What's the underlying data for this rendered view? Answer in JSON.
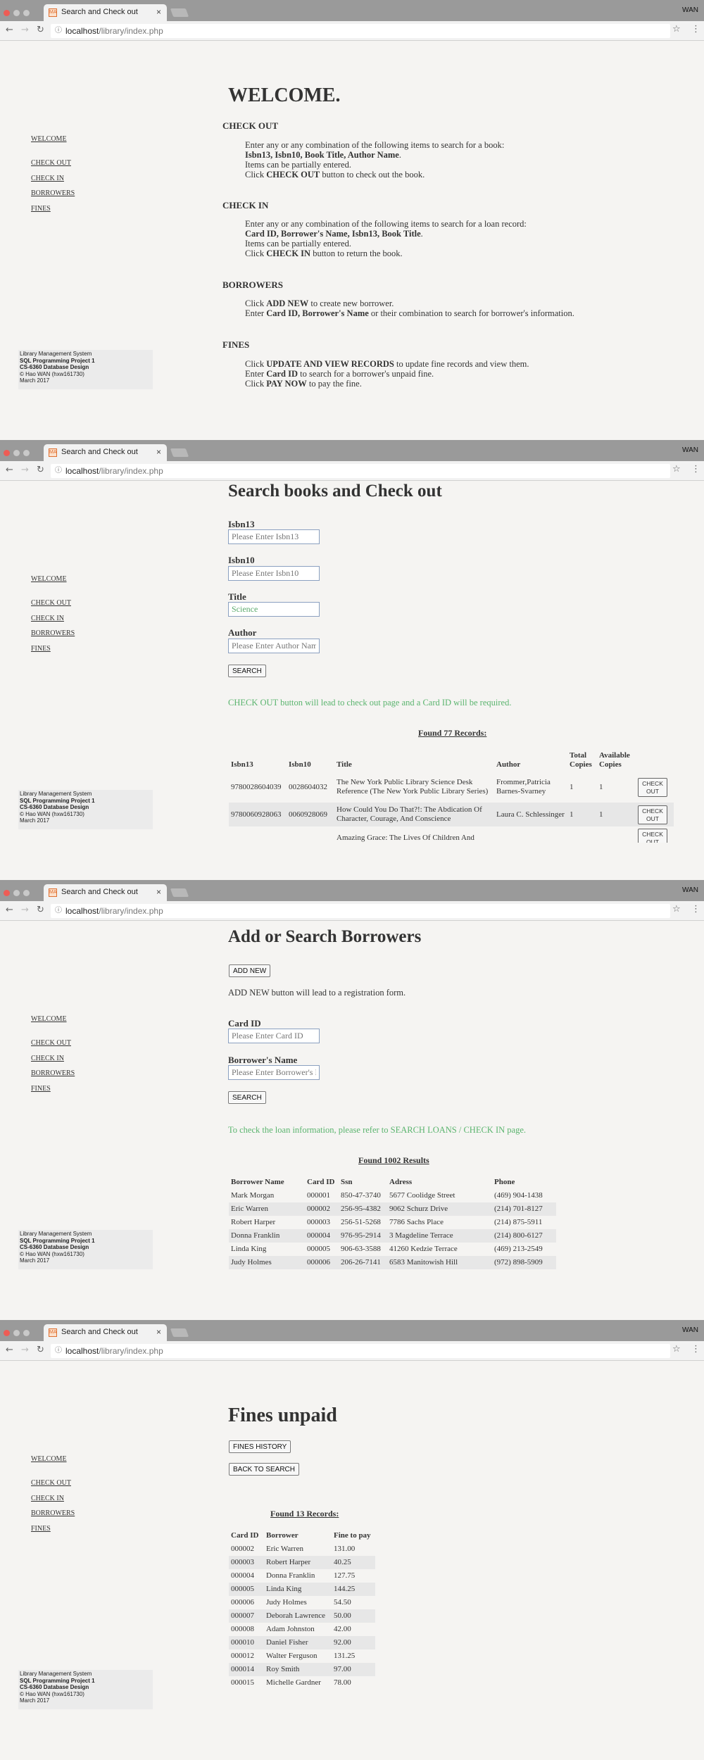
{
  "browser": {
    "tab_title": "Search and Check out",
    "favicon_text": "MA",
    "tab_close": "×",
    "user": "WAN",
    "url_host": "localhost",
    "url_path": "/library/index.php",
    "back_icon": "←",
    "forward_icon": "→",
    "reload_icon": "↻",
    "info_icon": "ⓘ",
    "star_icon": "☆",
    "menu_icon": "⋮"
  },
  "nav": {
    "welcome": "WELCOME",
    "checkout": "CHECK OUT",
    "checkin": "CHECK IN",
    "borrowers": "BORROWERS",
    "fines": "FINES"
  },
  "footer": {
    "line1": "Library Management System",
    "line2": "SQL Programming Project 1",
    "line3": "CS-6360 Database Design",
    "line4": "© Hao WAN (hxw161730)",
    "line5": "March 2017"
  },
  "welcome": {
    "title": "WELCOME.",
    "checkout": {
      "heading": "CHECK OUT",
      "l1": "Enter any or any combination of the following items to search for a book:",
      "l2a": "Isbn13, Isbn10, Book Title, Author Name",
      "l2b": ".",
      "l3": "Items can be partially entered.",
      "l4a": "Click ",
      "l4b": "CHECK OUT",
      "l4c": " button to check out the book."
    },
    "checkin": {
      "heading": "CHECK IN",
      "l1": "Enter any or any combination of the following items to search for a loan record:",
      "l2a": "Card ID, Borrower's Name, Isbn13, Book Title",
      "l2b": ".",
      "l3": "Items can be partially entered.",
      "l4a": "Click ",
      "l4b": "CHECK IN",
      "l4c": " button to return the book."
    },
    "borrowers": {
      "heading": "BORROWERS",
      "l1a": "Click ",
      "l1b": "ADD NEW",
      "l1c": " to create new borrower.",
      "l2a": "Enter ",
      "l2b": "Card ID, Borrower's Name",
      "l2c": " or their combination to search for borrower's information."
    },
    "fines": {
      "heading": "FINES",
      "l1a": "Click ",
      "l1b": "UPDATE AND VIEW RECORDS",
      "l1c": " to update fine records and view them.",
      "l2a": "Enter ",
      "l2b": "Card ID",
      "l2c": " to search for a borrower's unpaid fine.",
      "l3a": "Click ",
      "l3b": "PAY NOW",
      "l3c": " to pay the fine."
    }
  },
  "search_books": {
    "title": "Search books and Check out",
    "isbn13_label": "Isbn13",
    "isbn13_placeholder": "Please Enter Isbn13",
    "isbn10_label": "Isbn10",
    "isbn10_placeholder": "Please Enter Isbn10",
    "title_label": "Title",
    "title_value": "Science",
    "author_label": "Author",
    "author_placeholder": "Please Enter Author Name",
    "search_button": "SEARCH",
    "note": "CHECK OUT button will lead to check out page and a Card ID will be required.",
    "found": "Found 77 Records:",
    "columns": [
      "Isbn13",
      "Isbn10",
      "Title",
      "Author",
      "Total Copies",
      "Available Copies"
    ],
    "checkout_button": "CHECK OUT",
    "rows": [
      [
        "9780028604039",
        "0028604032",
        "The New York Public Library Science Desk Reference (The New York Public Library Series)",
        "Frommer,Patricia Barnes-Svarney",
        "1",
        "1"
      ],
      [
        "9780060928063",
        "0060928069",
        "How Could You Do That?!: The Abdication Of Character, Courage, And Conscience",
        "Laura C. Schlessinger",
        "1",
        "1"
      ],
      [
        "",
        "",
        "Amazing Grace: The Lives Of Children And",
        "",
        "",
        ""
      ]
    ]
  },
  "borrowers_page": {
    "title": "Add or Search Borrowers",
    "add_new_button": "ADD NEW",
    "add_note": "ADD NEW button will lead to a registration form.",
    "card_label": "Card ID",
    "card_placeholder": "Please Enter Card ID",
    "name_label": "Borrower's Name",
    "name_placeholder": "Please Enter Borrower's Name",
    "search_button": "SEARCH",
    "note": "To check the loan information, please refer to SEARCH LOANS / CHECK IN page.",
    "found": "Found 1002 Results",
    "columns": [
      "Borrower Name",
      "Card ID",
      "Ssn",
      "Adress",
      "Phone"
    ],
    "rows": [
      [
        "Mark Morgan",
        "000001",
        "850-47-3740",
        "5677 Coolidge Street",
        "(469) 904-1438"
      ],
      [
        "Eric Warren",
        "000002",
        "256-95-4382",
        "9062 Schurz Drive",
        "(214) 701-8127"
      ],
      [
        "Robert Harper",
        "000003",
        "256-51-5268",
        "7786 Sachs Place",
        "(214) 875-5911"
      ],
      [
        "Donna Franklin",
        "000004",
        "976-95-2914",
        "3 Magdeline Terrace",
        "(214) 800-6127"
      ],
      [
        "Linda King",
        "000005",
        "906-63-3588",
        "41260 Kedzie Terrace",
        "(469) 213-2549"
      ],
      [
        "Judy Holmes",
        "000006",
        "206-26-7141",
        "6583 Manitowish Hill",
        "(972) 898-5909"
      ]
    ]
  },
  "fines_page": {
    "title": "Fines unpaid",
    "history_button": "FINES HISTORY",
    "back_button": "BACK TO SEARCH",
    "found": "Found 13 Records:",
    "columns": [
      "Card ID",
      "Borrower",
      "Fine to pay"
    ],
    "rows": [
      [
        "000002",
        "Eric Warren",
        "131.00"
      ],
      [
        "000003",
        "Robert Harper",
        "40.25"
      ],
      [
        "000004",
        "Donna Franklin",
        "127.75"
      ],
      [
        "000005",
        "Linda King",
        "144.25"
      ],
      [
        "000006",
        "Judy Holmes",
        "54.50"
      ],
      [
        "000007",
        "Deborah Lawrence",
        "50.00"
      ],
      [
        "000008",
        "Adam Johnston",
        "42.00"
      ],
      [
        "000010",
        "Daniel Fisher",
        "92.00"
      ],
      [
        "000012",
        "Walter Ferguson",
        "131.25"
      ],
      [
        "000014",
        "Roy Smith",
        "97.00"
      ],
      [
        "000015",
        "Michelle Gardner",
        "78.00"
      ]
    ]
  }
}
